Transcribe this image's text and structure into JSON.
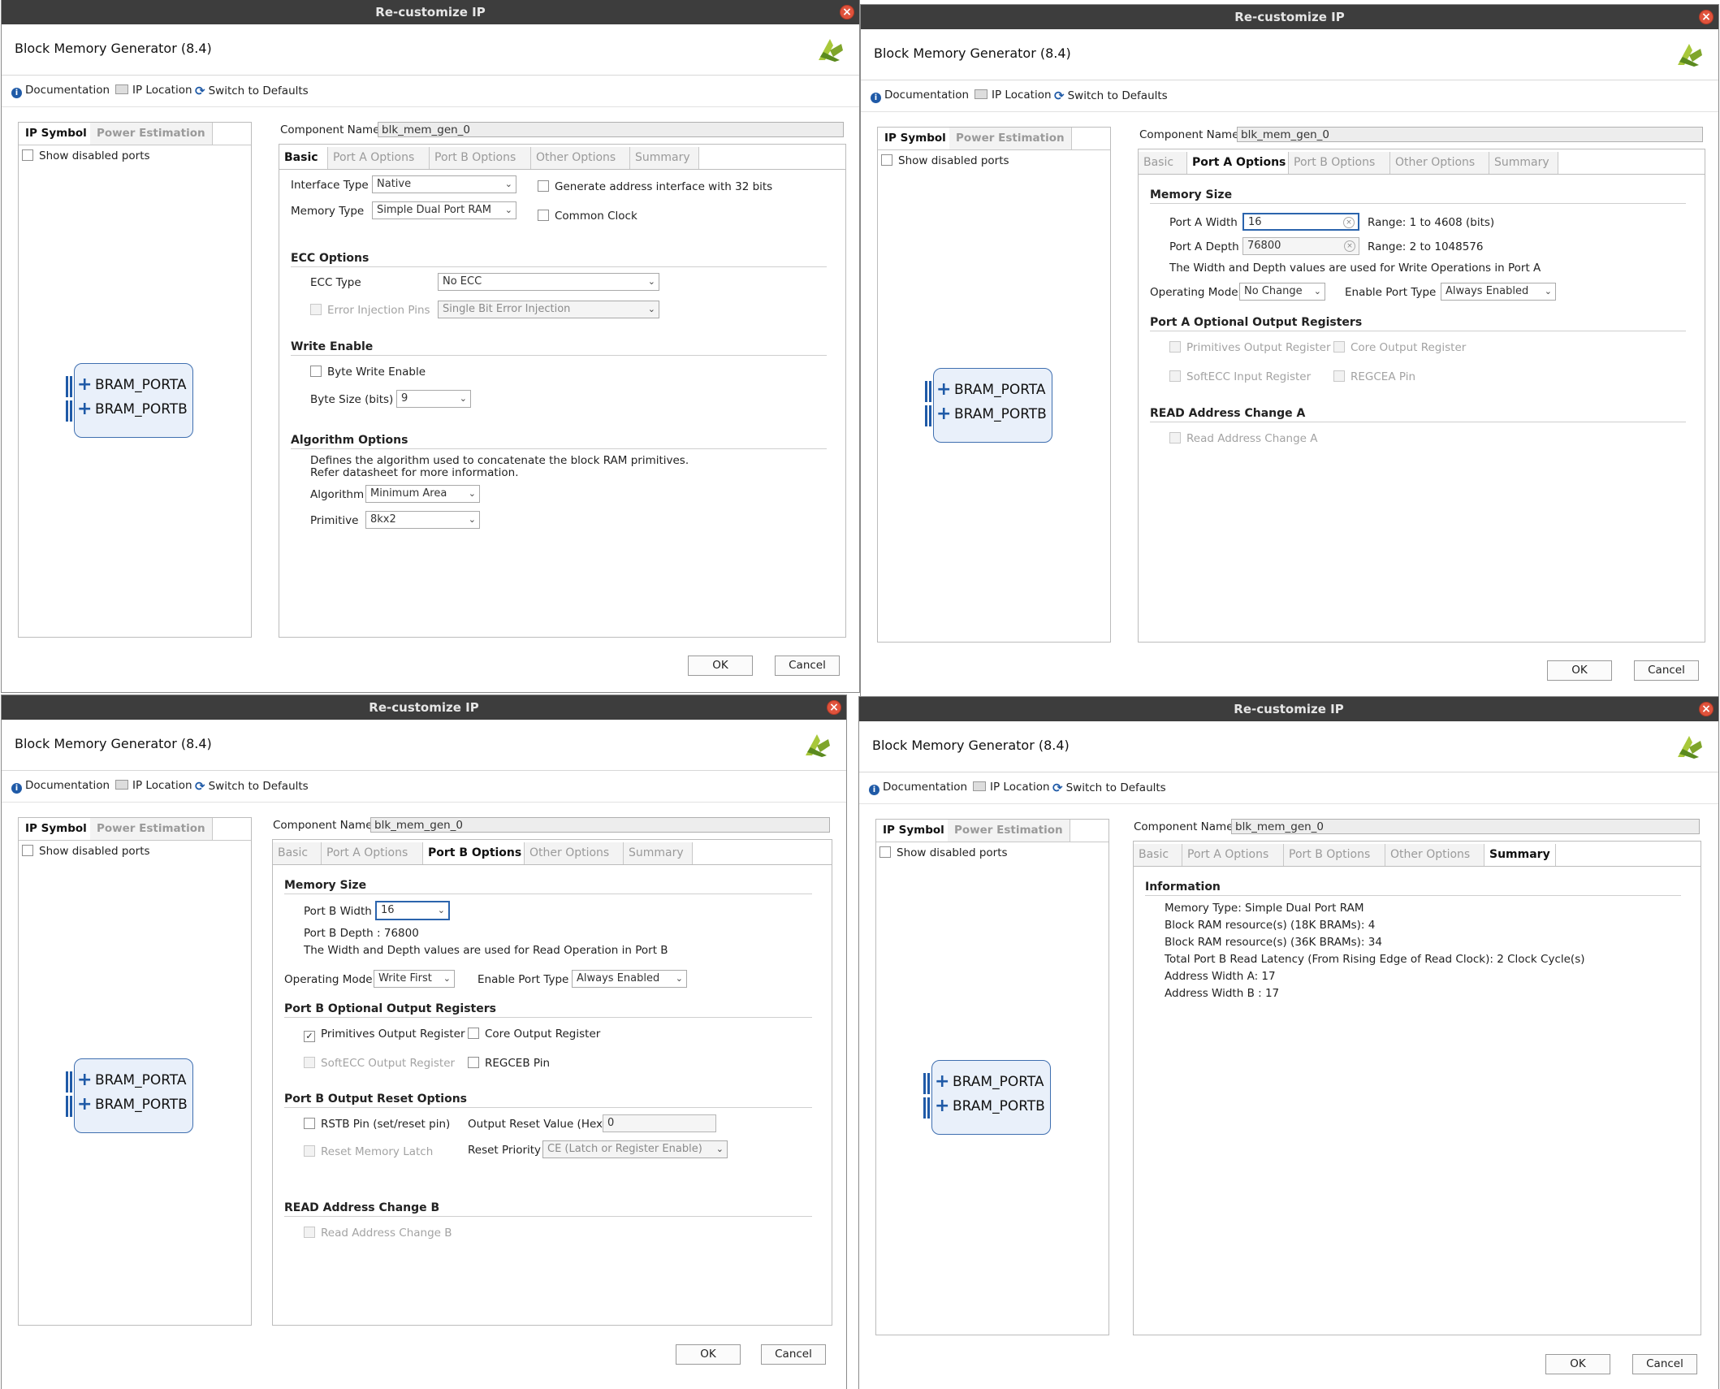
{
  "common": {
    "title": "Re-customize IP",
    "ip_name": "Block Memory Generator (8.4)",
    "toolbar": {
      "documentation": "Documentation",
      "ip_location": "IP Location",
      "switch_defaults": "Switch to Defaults"
    },
    "left_tabs": {
      "ip_symbol": "IP Symbol",
      "power_estimation": "Power Estimation"
    },
    "show_disabled_ports": "Show disabled ports",
    "ports": {
      "a": "BRAM_PORTA",
      "b": "BRAM_PORTB"
    },
    "component_name_label": "Component Name",
    "component_name": "blk_mem_gen_0",
    "tabs": {
      "basic": "Basic",
      "port_a": "Port A Options",
      "port_b": "Port B Options",
      "other": "Other Options",
      "summary": "Summary"
    },
    "ok": "OK",
    "cancel": "Cancel",
    "colors": {
      "titlebar": "#3d3d3d",
      "accent": "#1f5aa7",
      "close": "#e0533c"
    }
  },
  "basic": {
    "interface_type_label": "Interface Type",
    "interface_type": "Native",
    "memory_type_label": "Memory Type",
    "memory_type": "Simple Dual Port RAM",
    "gen_addr_32": "Generate address interface with 32 bits",
    "common_clock": "Common Clock",
    "ecc_section": "ECC Options",
    "ecc_type_label": "ECC Type",
    "ecc_type": "No ECC",
    "error_injection_label": "Error Injection Pins",
    "error_injection": "Single Bit Error Injection",
    "write_enable_section": "Write Enable",
    "byte_write_enable": "Byte Write Enable",
    "byte_size_label": "Byte Size (bits)",
    "byte_size": "9",
    "algo_section": "Algorithm Options",
    "algo_desc1": "Defines the algorithm used to concatenate the block RAM primitives.",
    "algo_desc2": "Refer datasheet for more information.",
    "algorithm_label": "Algorithm",
    "algorithm": "Minimum Area",
    "primitive_label": "Primitive",
    "primitive": "8kx2"
  },
  "porta": {
    "memory_size": "Memory Size",
    "width_label": "Port A Width",
    "width": "16",
    "width_range": "Range: 1 to 4608 (bits)",
    "depth_label": "Port A Depth",
    "depth": "76800",
    "depth_range": "Range: 2 to 1048576",
    "note": "The Width and Depth values are used for Write Operations in Port A",
    "op_mode_label": "Operating Mode",
    "op_mode": "No Change",
    "enable_port_label": "Enable Port Type",
    "enable_port": "Always Enabled",
    "opt_regs_section": "Port A Optional Output Registers",
    "prim_out_reg": "Primitives Output Register",
    "core_out_reg": "Core Output Register",
    "softecc_in_reg": "SoftECC Input Register",
    "regcea": "REGCEA Pin",
    "read_addr_section": "READ Address Change A",
    "read_addr": "Read Address Change A"
  },
  "portb": {
    "memory_size": "Memory Size",
    "width_label": "Port B Width",
    "width": "16",
    "depth_text": "Port B Depth : 76800",
    "note": "The Width and Depth values are used for Read Operation in Port B",
    "op_mode_label": "Operating Mode",
    "op_mode": "Write First",
    "enable_port_label": "Enable Port Type",
    "enable_port": "Always Enabled",
    "opt_regs_section": "Port B Optional Output Registers",
    "prim_out_reg": "Primitives Output Register",
    "prim_out_check": "✓",
    "core_out_reg": "Core Output Register",
    "softecc_out_reg": "SoftECC Output Register",
    "regceb": "REGCEB Pin",
    "reset_section": "Port B Output Reset Options",
    "rstb_pin": "RSTB Pin (set/reset pin)",
    "reset_value_label": "Output Reset Value (Hex)",
    "reset_value": "0",
    "reset_mem_latch": "Reset Memory Latch",
    "reset_priority_label": "Reset Priority",
    "reset_priority": "CE (Latch or Register Enable)",
    "read_addr_section": "READ Address Change B",
    "read_addr": "Read Address Change B"
  },
  "summary": {
    "info_section": "Information",
    "lines": [
      "Memory Type: Simple Dual Port RAM",
      "Block RAM resource(s) (18K BRAMs): 4",
      "Block RAM resource(s) (36K BRAMs): 34",
      "Total Port B Read Latency (From Rising Edge of Read Clock): 2 Clock Cycle(s)",
      "Address Width A: 17",
      "Address Width B : 17"
    ]
  }
}
